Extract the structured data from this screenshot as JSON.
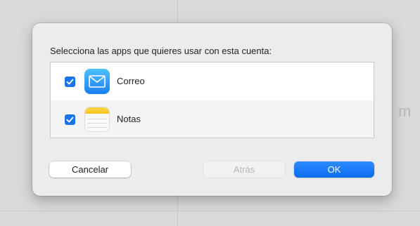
{
  "backdrop": {
    "partial_glyph": "m"
  },
  "dialog": {
    "prompt": "Selecciona las apps que quieres usar con esta cuenta:",
    "apps": [
      {
        "label": "Correo",
        "checked": true,
        "icon": "mail-icon"
      },
      {
        "label": "Notas",
        "checked": true,
        "icon": "notes-icon"
      }
    ],
    "buttons": {
      "cancel": "Cancelar",
      "back": "Atrás",
      "ok": "OK"
    }
  },
  "colors": {
    "accent": "#1a73e8",
    "ok_button": "#0a6cf2",
    "disabled_text": "#b5b5b5",
    "sheet_background": "#ececec"
  }
}
